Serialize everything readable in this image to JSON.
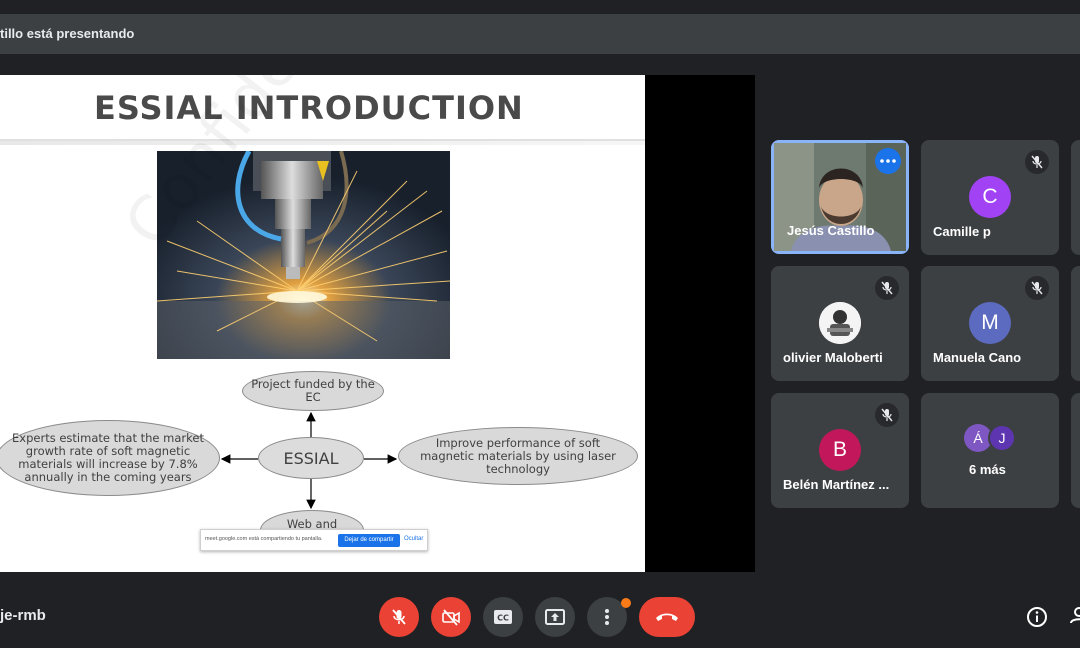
{
  "topbar": {
    "presenting_text": "tillo está presentando"
  },
  "slide": {
    "title": "ESSIAL INTRODUCTION",
    "watermark": "Confidential",
    "diagram": {
      "center": "ESSIAL",
      "top": "Project funded by the EC",
      "left": "Experts estimate that the market growth rate of soft magnetic materials will increase by 7.8% annually in the coming years",
      "right": "Improve performance of soft magnetic materials by using laser technology",
      "bottom": "Web and"
    },
    "share_bar": {
      "message": "meet.google.com está compartiendo tu pantalla.",
      "stop_label": "Dejar de compartir",
      "hide_label": "Ocultar"
    }
  },
  "participants": [
    {
      "name": "Jesús Castillo",
      "type": "video"
    },
    {
      "name": "Camille p",
      "initial": "C",
      "color": "#a142f4",
      "muted": true
    },
    {
      "name": "olivier Maloberti",
      "type": "image",
      "muted": true
    },
    {
      "name": "Manuela Cano",
      "initial": "M",
      "color": "#5c6bc0",
      "muted": true
    },
    {
      "name": "Belén Martínez ...",
      "initial": "B",
      "color": "#c2185b",
      "muted": true
    },
    {
      "name": "6 más",
      "initials": [
        "Á",
        "J"
      ],
      "colors": [
        "#7e57c2",
        "#5e35b1"
      ]
    }
  ],
  "meeting_code": "je-rmb",
  "controls": {
    "mic": "mic-off-icon",
    "camera": "camera-off-icon",
    "captions": "captions-icon",
    "present": "present-icon",
    "more": "more-options-icon",
    "end_call": "end-call-icon",
    "info": "info-icon",
    "people": "people-icon"
  },
  "colors": {
    "accent_red": "#ea4335",
    "active_blue": "#8ab4f8",
    "badge_orange": "#fa7b17"
  }
}
